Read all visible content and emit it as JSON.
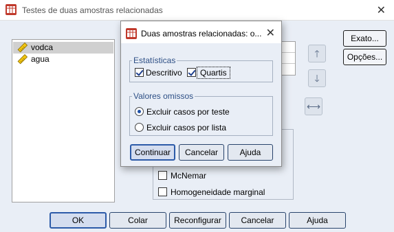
{
  "main_window": {
    "title": "Testes de duas amostras relacionadas",
    "close_glyph": "✕"
  },
  "variables": [
    {
      "name": "vodca",
      "icon": "scale-ruler-icon",
      "selected": true
    },
    {
      "name": "agua",
      "icon": "scale-ruler-icon",
      "selected": false
    }
  ],
  "side_buttons": {
    "exact": "Exato...",
    "options": "Opções..."
  },
  "tests": {
    "mcnemar": "McNemar",
    "marginal_homogeneity": "Homogeneidade marginal"
  },
  "bottom_buttons": {
    "ok": "OK",
    "paste": "Colar",
    "reset": "Reconfigurar",
    "cancel": "Cancelar",
    "help": "Ajuda"
  },
  "dialog": {
    "title": "Duas amostras relacionadas: o...",
    "close_glyph": "✕",
    "statistics": {
      "legend": "Estatísticas",
      "descriptive": {
        "label": "Descritivo",
        "checked": true
      },
      "quartiles": {
        "label": "Quartis",
        "checked": true
      }
    },
    "missing": {
      "legend": "Valores omissos",
      "by_test": {
        "label": "Excluir casos por teste",
        "selected": true
      },
      "listwise": {
        "label": "Excluir casos por lista",
        "selected": false
      }
    },
    "buttons": {
      "continue": "Continuar",
      "cancel": "Cancelar",
      "help": "Ajuda"
    }
  },
  "colors": {
    "window_bg": "#e9eef6",
    "accent": "#2b5aa8",
    "legend_text": "#2d4f85"
  }
}
